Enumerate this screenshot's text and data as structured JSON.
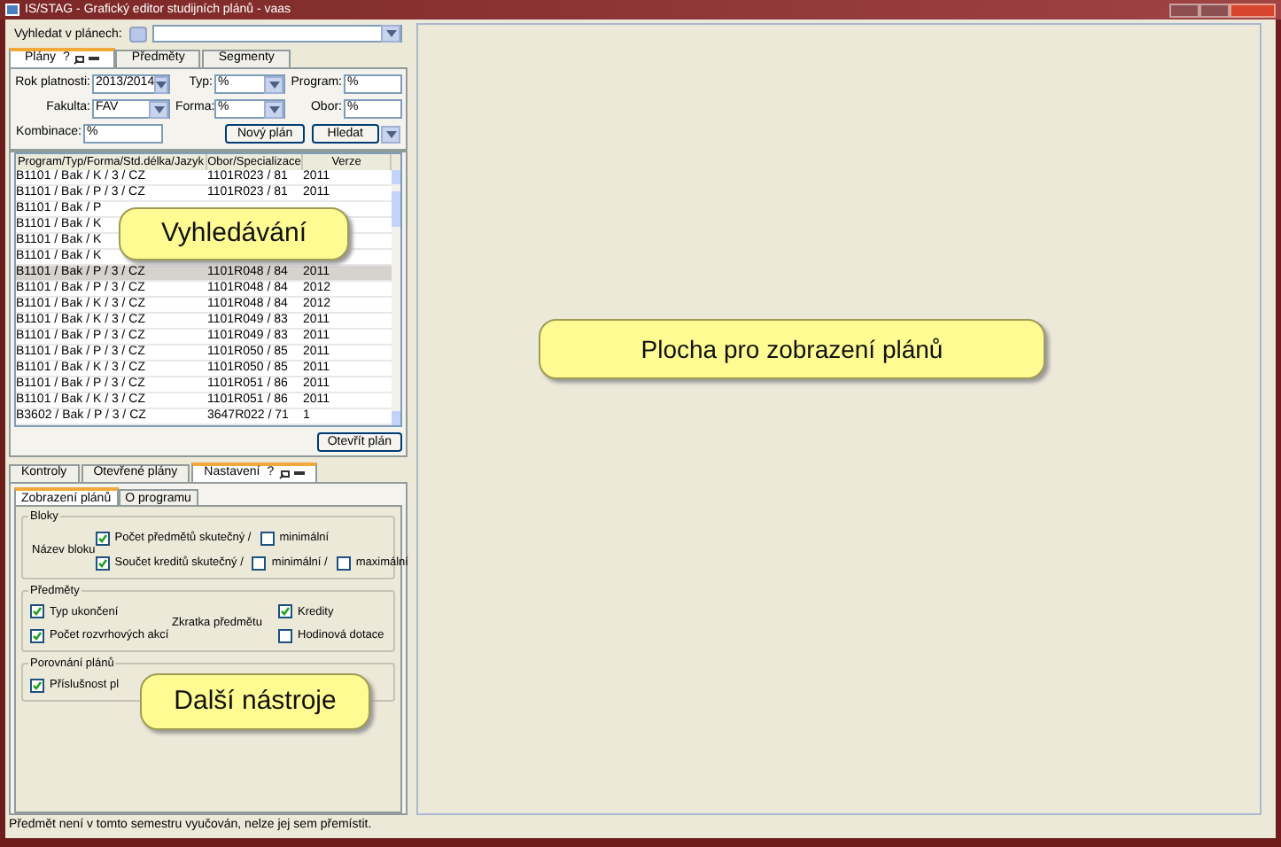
{
  "window": {
    "title": "IS/STAG - Grafický editor studijních plánů - vaas"
  },
  "search": {
    "label": "Vyhledat v plánech:"
  },
  "top_tabs": [
    {
      "label": "Plány",
      "selected": true,
      "help": "?"
    },
    {
      "label": "Předměty",
      "selected": false
    },
    {
      "label": "Segmenty",
      "selected": false
    }
  ],
  "filters": [
    {
      "kind": "select",
      "label": "Rok platnosti:",
      "value": "2013/2014"
    },
    {
      "kind": "select",
      "label": "Typ:",
      "value": "%"
    },
    {
      "kind": "input",
      "label": "Program:",
      "value": "%"
    },
    {
      "kind": "select",
      "label": "Fakulta:",
      "value": "FAV"
    },
    {
      "kind": "select",
      "label": "Forma:",
      "value": "%"
    },
    {
      "kind": "input",
      "label": "Obor:",
      "value": "%"
    }
  ],
  "combination": {
    "label": "Kombinace:",
    "value": "%"
  },
  "new_plan_button": "Nový plán",
  "search_button": "Hledat",
  "table": {
    "columns": [
      "Program/Typ/Forma/Std.délka/Jazyk",
      "Obor/Specializace",
      "Verze"
    ],
    "rows": [
      {
        "selected": false,
        "cells": [
          "B1101 / Bak / K / 3 / CZ",
          "1101R023 / 81",
          "2011"
        ]
      },
      {
        "selected": false,
        "cells": [
          "B1101 / Bak / P / 3 / CZ",
          "1101R023 / 81",
          "2011"
        ]
      },
      {
        "selected": false,
        "cells": [
          "B1101 / Bak / P"
        ]
      },
      {
        "selected": false,
        "cells": [
          "B1101 / Bak / K"
        ]
      },
      {
        "selected": false,
        "cells": [
          "B1101 / Bak / K"
        ]
      },
      {
        "selected": false,
        "cells": [
          "B1101 / Bak / K"
        ]
      },
      {
        "selected": true,
        "cells": [
          "B1101 / Bak / P / 3 / CZ",
          "1101R048 / 84",
          "2011"
        ]
      },
      {
        "selected": false,
        "cells": [
          "B1101 / Bak / P / 3 / CZ",
          "1101R048 / 84",
          "2012"
        ]
      },
      {
        "selected": false,
        "cells": [
          "B1101 / Bak / K / 3 / CZ",
          "1101R048 / 84",
          "2012"
        ]
      },
      {
        "selected": false,
        "cells": [
          "B1101 / Bak / K / 3 / CZ",
          "1101R049 / 83",
          "2011"
        ]
      },
      {
        "selected": false,
        "cells": [
          "B1101 / Bak / P / 3 / CZ",
          "1101R049 / 83",
          "2011"
        ]
      },
      {
        "selected": false,
        "cells": [
          "B1101 / Bak / P / 3 / CZ",
          "1101R050 / 85",
          "2011"
        ]
      },
      {
        "selected": false,
        "cells": [
          "B1101 / Bak / K / 3 / CZ",
          "1101R050 / 85",
          "2011"
        ]
      },
      {
        "selected": false,
        "cells": [
          "B1101 / Bak / P / 3 / CZ",
          "1101R051 / 86",
          "2011"
        ]
      },
      {
        "selected": false,
        "cells": [
          "B1101 / Bak / K / 3 / CZ",
          "1101R051 / 86",
          "2011"
        ]
      },
      {
        "selected": false,
        "cells": [
          "B3602 / Bak / P / 3 / CZ",
          "3647R022 / 71",
          "1"
        ]
      }
    ]
  },
  "open_plan_button": "Otevřít plán",
  "bottom_tabs": [
    {
      "label": "Kontroly",
      "selected": false
    },
    {
      "label": "Otevřené plány",
      "selected": false
    },
    {
      "label": "Nastavení",
      "selected": true,
      "help": "?"
    }
  ],
  "sub_tabs": [
    {
      "label": "Zobrazení plánů",
      "selected": true
    },
    {
      "label": "O programu",
      "selected": false
    }
  ],
  "blocks": {
    "title": "Bloky",
    "label": "Název bloku",
    "rows": [
      [
        {
          "label": "Počet předmětů skutečný /",
          "checked": true
        },
        {
          "label": "minimální",
          "checked": false
        }
      ],
      [
        {
          "label": "Součet kreditů skutečný /",
          "checked": true
        },
        {
          "label": "minimální /",
          "checked": false
        },
        {
          "label": "maximální",
          "checked": false
        }
      ]
    ]
  },
  "subjects": {
    "title": "Předměty",
    "left": [
      {
        "label": "Typ ukončení",
        "checked": true
      },
      {
        "label": "Počet rozvrhových akcí",
        "checked": true
      }
    ],
    "label": "Zkratka předmětu",
    "right": [
      {
        "label": "Kredity",
        "checked": true
      },
      {
        "label": "Hodinová dotace",
        "checked": false
      }
    ]
  },
  "compare": {
    "title": "Porovnání plánů",
    "items": [
      {
        "label": "Příslušnost pl",
        "checked": true
      }
    ]
  },
  "callouts": [
    "Vyhledávání",
    "Další nástroje",
    "Plocha pro zobrazení plánů"
  ],
  "status_bar": "Předmět není v tomto semestru vyučován, nelze jej sem přemístit."
}
